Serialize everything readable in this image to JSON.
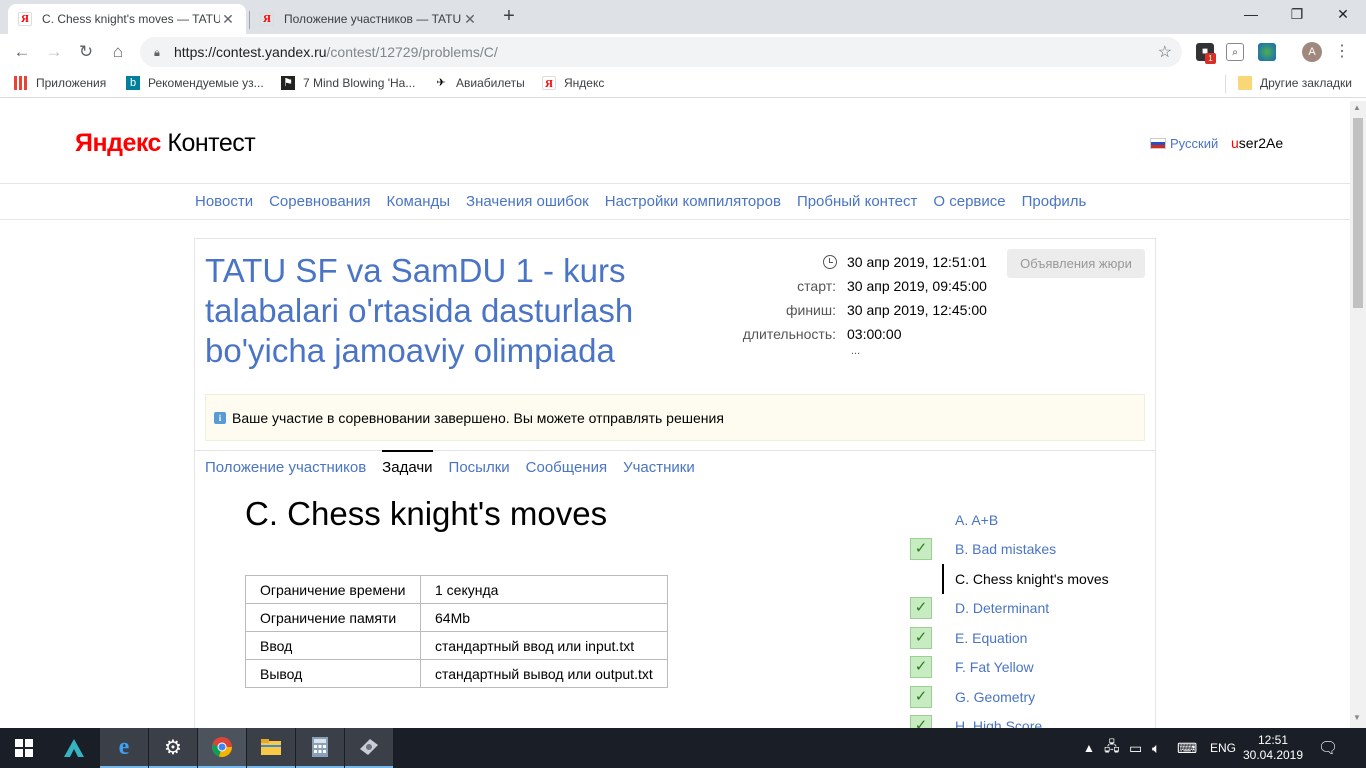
{
  "browser": {
    "tabs": [
      {
        "title": "C. Chess knight's moves — TATU",
        "favicon": "Я",
        "active": true
      },
      {
        "title": "Положение участников — TATU",
        "favicon": "Я",
        "active": false
      }
    ],
    "new_tab": "+",
    "window_controls": {
      "minimize": "—",
      "restore": "❐",
      "close": "✕"
    },
    "url_host": "https://contest.yandex.ru",
    "url_path": "/contest/12729/problems/C/",
    "profile_initial": "A",
    "ext_badge": "1",
    "bookmarks": [
      {
        "label": "Приложения",
        "icon": "apps-grid-icon"
      },
      {
        "label": "Рекомендуемые уз...",
        "icon": "bing-icon"
      },
      {
        "label": "7 Mind Blowing 'Ha...",
        "icon": "page-icon"
      },
      {
        "label": "Авиабилеты",
        "icon": "plane-icon"
      },
      {
        "label": "Яндекс",
        "icon": "yandex-icon"
      }
    ],
    "other_bookmarks": "Другие закладки"
  },
  "site": {
    "logo_main": "Яндекс",
    "logo_sub": "Контест",
    "language": "Русский",
    "username_first": "u",
    "username_rest": "ser2Ae",
    "nav": [
      "Новости",
      "Соревнования",
      "Команды",
      "Значения ошибок",
      "Настройки компиляторов",
      "Пробный контест",
      "О сервисе",
      "Профиль"
    ]
  },
  "contest": {
    "title": "TATU SF va SamDU 1 - kurs talabalari o'rtasida dasturlash bo'yicha jamoaviy olimpiada",
    "current_time": "30 апр 2019, 12:51:01",
    "start_label": "старт:",
    "start": "30 апр 2019, 09:45:00",
    "finish_label": "финиш:",
    "finish": "30 апр 2019, 12:45:00",
    "duration_label": "длительность:",
    "duration": "03:00:00",
    "ellipsis": "...",
    "jury_button": "Объявления жюри",
    "notice": "Ваше участие в соревновании завершено. Вы можете отправлять решения",
    "tabs": [
      "Положение участников",
      "Задачи",
      "Посылки",
      "Сообщения",
      "Участники"
    ],
    "active_tab": "Задачи"
  },
  "problem": {
    "title": "C. Chess knight's moves",
    "limits": [
      {
        "label": "Ограничение времени",
        "value": "1 секунда"
      },
      {
        "label": "Ограничение памяти",
        "value": "64Mb"
      },
      {
        "label": "Ввод",
        "value": "стандартный ввод или input.txt"
      },
      {
        "label": "Вывод",
        "value": "стандартный вывод или output.txt"
      }
    ]
  },
  "problem_list": [
    {
      "name": "A. A+B",
      "solved": false,
      "current": false
    },
    {
      "name": "B. Bad mistakes",
      "solved": true,
      "current": false
    },
    {
      "name": "C. Chess knight's moves",
      "solved": false,
      "current": true
    },
    {
      "name": "D. Determinant",
      "solved": true,
      "current": false
    },
    {
      "name": "E. Equation",
      "solved": true,
      "current": false
    },
    {
      "name": "F. Fat Yellow",
      "solved": true,
      "current": false
    },
    {
      "name": "G. Geometry",
      "solved": true,
      "current": false
    },
    {
      "name": "H. High Score",
      "solved": true,
      "current": false
    }
  ],
  "taskbar": {
    "lang": "ENG",
    "time": "12:51",
    "date": "30.04.2019"
  }
}
